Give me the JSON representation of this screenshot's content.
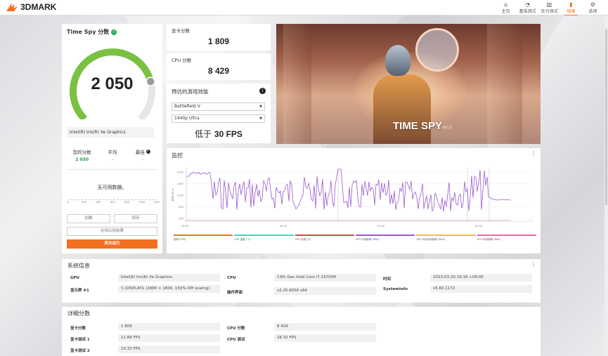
{
  "app": {
    "logo_text": "3DMARK",
    "nav": [
      {
        "label": "主页",
        "icon": "home-icon",
        "glyph": "⌂",
        "active": false
      },
      {
        "label": "基准测试",
        "icon": "gauge-icon",
        "glyph": "◔",
        "active": false
      },
      {
        "label": "压力测试",
        "icon": "stress-icon",
        "glyph": "▥",
        "active": false
      },
      {
        "label": "结果",
        "icon": "results-icon",
        "glyph": "▮",
        "active": true
      },
      {
        "label": "选项",
        "icon": "gear-icon",
        "glyph": "⚙",
        "active": false
      }
    ],
    "accent": "#f37021"
  },
  "score": {
    "title": "Time Spy 分数",
    "value": "2 050",
    "gauge_fraction": 0.78,
    "gpu_name": "Intel(R) Iris(R) Xe Graphics",
    "your_score_label": "您的分数",
    "your_score": "2 050",
    "average_label": "平均",
    "average": "-",
    "best_label": "最佳",
    "best": "-",
    "no_data": "无可用数据。",
    "mini_axis": [
      "0",
      "200",
      "400",
      "600",
      "800",
      "1000",
      "1200"
    ],
    "btn_load": "加载",
    "btn_save": "保存",
    "btn_compare": "在线比较结果",
    "btn_run_again": "再次运行"
  },
  "gpu_score": {
    "label": "显卡分数",
    "value": "1 809"
  },
  "cpu_score": {
    "label": "CPU 分数",
    "value": "8 429"
  },
  "perf": {
    "title": "预估的游戏效能",
    "game": "Battlefield V",
    "resolution": "1440p Ultra",
    "fps_prefix": "低于",
    "fps_value": "30 FPS"
  },
  "hero": {
    "title": "TIME SPY",
    "version": "(V1.2)"
  },
  "monitor": {
    "title": "监控",
    "y_axis_label": "频率 (MHz)",
    "y_ticks": [
      "2000",
      "1600",
      "1200",
      "800",
      "400"
    ],
    "x_ticks": [
      "00:00",
      "00:40",
      "01:20",
      "02:00"
    ],
    "legend": [
      {
        "label": "帧率 (FPS)",
        "color": "#f37021"
      },
      {
        "label": "CPU 温度 (°C)",
        "color": "#4fd1c5"
      },
      {
        "label": "GPU 负载 (%)",
        "color": "#d64545"
      },
      {
        "label": "CPU 时钟频率 (MHz)",
        "color": "#9b59d0"
      },
      {
        "label": "GPU 内存时钟频率 (MHz)",
        "color": "#f0c419"
      },
      {
        "label": "GPU 时钟频率 (MHz)",
        "color": "#e86aa8"
      }
    ]
  },
  "sysinfo": {
    "title": "系统信息",
    "gpu_label": "GPU",
    "gpu_value": "Intel(R) Iris(R) Xe Graphics",
    "display_label": "显示屏 #1",
    "display_value": "\\\\.\\DISPLAY1 (2880 × 1800, 150% DPI scaling)",
    "cpu_label": "CPU",
    "cpu_value": "13th Gen Intel Core i7-13700H",
    "os_label": "操作界面",
    "os_value": "v2.25.8056 s64",
    "time_label": "时间",
    "time_value": "2023-03-20 16:16 +08:00",
    "sysinfo_label": "SystemInfo",
    "sysinfo_value": "v5.60.1172"
  },
  "details": {
    "title": "详细分数",
    "gpu_score_label": "显卡分数",
    "gpu_score_value": "1 809",
    "gpu_test1_label": "显卡测试 1",
    "gpu_test1_value": "11.84 FPS",
    "gpu_test2_label": "显卡测试 2",
    "gpu_test2_value": "10.33 FPS",
    "cpu_score_label": "CPU 分数",
    "cpu_score_value": "8 429",
    "cpu_test_label": "CPU 测试",
    "cpu_test_value": "28.32 FPS"
  }
}
